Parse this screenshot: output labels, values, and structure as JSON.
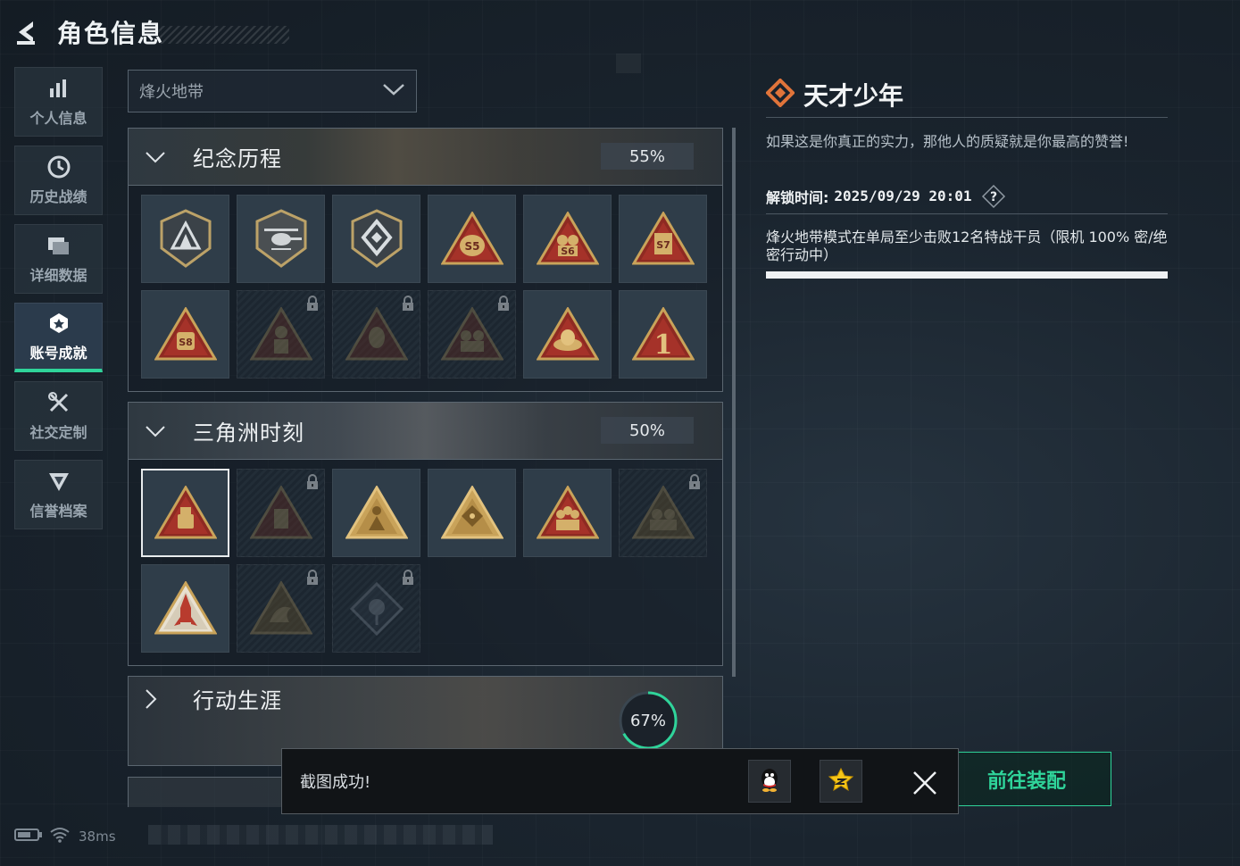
{
  "header": {
    "title": "角色信息",
    "back_icon": "back-arrow-icon"
  },
  "sidebar": {
    "items": [
      {
        "label": "个人信息",
        "icon": "bar-chart-icon",
        "active": false
      },
      {
        "label": "历史战绩",
        "icon": "clock-icon",
        "active": false
      },
      {
        "label": "详细数据",
        "icon": "folder-icon",
        "active": false
      },
      {
        "label": "账号成就",
        "icon": "medal-icon",
        "active": true
      },
      {
        "label": "社交定制",
        "icon": "tools-icon",
        "active": false
      },
      {
        "label": "信誉档案",
        "icon": "shield-icon",
        "active": false
      }
    ]
  },
  "dropdown": {
    "selected": "烽火地带"
  },
  "sections": [
    {
      "name": "纪念历程",
      "percent": "55%",
      "expanded": true,
      "badges": [
        {
          "icon": "shield-mountain-badge-icon",
          "locked": false
        },
        {
          "icon": "helicopter-badge-icon",
          "locked": false
        },
        {
          "icon": "diamond-emblem-badge-icon",
          "locked": false
        },
        {
          "icon": "s5-bag-badge-icon",
          "label": "S5",
          "locked": false
        },
        {
          "icon": "s6-badge-icon",
          "label": "S6",
          "locked": false
        },
        {
          "icon": "s7-badge-icon",
          "label": "S7",
          "locked": false
        },
        {
          "icon": "s8-badge-icon",
          "label": "S8",
          "locked": false
        },
        {
          "icon": "s9-soldier-badge-icon",
          "label": "S9",
          "locked": true
        },
        {
          "icon": "operator-portrait-badge-icon",
          "locked": true
        },
        {
          "icon": "soldiers-badge-icon",
          "locked": true
        },
        {
          "icon": "egg-nest-badge-icon",
          "locked": false
        },
        {
          "icon": "number-one-badge-icon",
          "label": "1",
          "locked": false
        }
      ]
    },
    {
      "name": "三角洲时刻",
      "percent": "50%",
      "expanded": true,
      "badges": [
        {
          "icon": "usb-drive-badge-icon",
          "locked": false,
          "selected": true
        },
        {
          "icon": "portrait-badge-icon",
          "locked": true
        },
        {
          "icon": "kneeling-figure-badge-icon",
          "locked": false
        },
        {
          "icon": "dice-badge-icon",
          "locked": false
        },
        {
          "icon": "squad-badge-icon",
          "locked": false
        },
        {
          "icon": "group-badge-icon",
          "locked": true
        },
        {
          "icon": "rocket-badge-icon",
          "locked": false
        },
        {
          "icon": "dragon-badge-icon",
          "locked": true
        },
        {
          "icon": "rose-badge-icon",
          "locked": true
        }
      ]
    },
    {
      "name": "行动生涯",
      "percent": "67%",
      "percent_value": 0.67,
      "expanded": false
    }
  ],
  "detail": {
    "title": "天才少年",
    "description": "如果这是你真正的实力，那他人的质疑就是你最高的赞誉!",
    "unlock_label": "解锁时间:",
    "unlock_time": "2025/09/29 20:01",
    "help_icon": "question-icon",
    "requirement": "烽火地带模式在单局至少击败12名特战干员（限机 100% 密/绝密行动中）",
    "progress": 1.0
  },
  "equip_button": {
    "label": "前往装配"
  },
  "toast": {
    "message": "截图成功!",
    "share_buttons": [
      "qq-icon",
      "qzone-star-icon"
    ],
    "close_icon": "close-icon"
  },
  "status_bar": {
    "ping": "38ms"
  },
  "colors": {
    "accent": "#2fd49a",
    "badge_gold": "#c9a35a",
    "badge_red": "#8e2a22",
    "detail_icon": "#e0743a"
  }
}
